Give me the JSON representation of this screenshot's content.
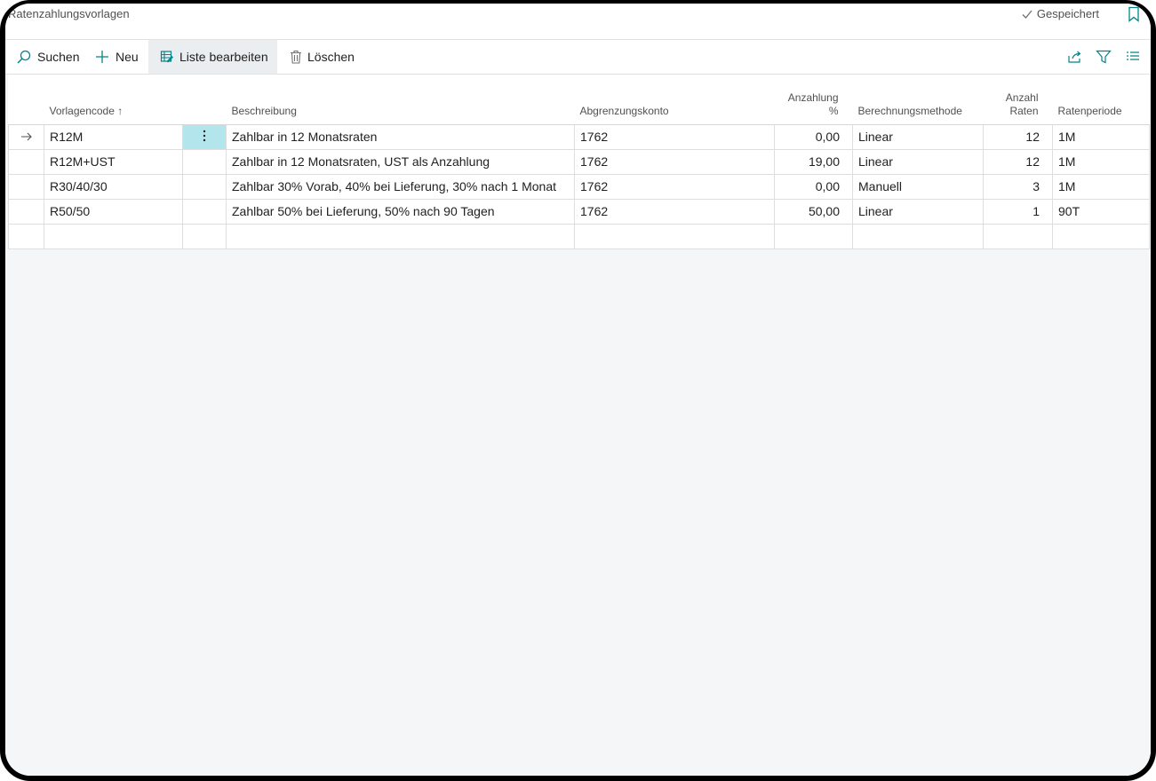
{
  "page": {
    "title": "Ratenzahlungsvorlagen",
    "status": "Gespeichert"
  },
  "actions": {
    "search": "Suchen",
    "new": "Neu",
    "edit_list": "Liste bearbeiten",
    "delete": "Löschen"
  },
  "columns": {
    "code": "Vorlagencode",
    "code_sort": "↑",
    "description": "Beschreibung",
    "account": "Abgrenzungskonto",
    "down_payment_line1": "Anzahlung",
    "down_payment_line2": "%",
    "method": "Berechnungsmethode",
    "count_line1": "Anzahl",
    "count_line2": "Raten",
    "period": "Ratenperiode"
  },
  "rows": [
    {
      "code": "R12M",
      "description": "Zahlbar in 12 Monatsraten",
      "account": "1762",
      "down_payment": "0,00",
      "method": "Linear",
      "count": "12",
      "period": "1M"
    },
    {
      "code": "R12M+UST",
      "description": "Zahlbar in 12 Monatsraten, UST als Anzahlung",
      "account": "1762",
      "down_payment": "19,00",
      "method": "Linear",
      "count": "12",
      "period": "1M"
    },
    {
      "code": "R30/40/30",
      "description": "Zahlbar 30% Vorab, 40% bei Lieferung, 30% nach 1 Monat",
      "account": "1762",
      "down_payment": "0,00",
      "method": "Manuell",
      "count": "3",
      "period": "1M"
    },
    {
      "code": "R50/50",
      "description": "Zahlbar 50% bei Lieferung, 50% nach 90 Tagen",
      "account": "1762",
      "down_payment": "50,00",
      "method": "Linear",
      "count": "1",
      "period": "90T"
    }
  ],
  "colors": {
    "accent": "#008489",
    "selected_cell": "#b3e5ec"
  },
  "icons": {
    "status": "check-icon",
    "bookmark": "bookmark-icon",
    "search": "search-icon",
    "new": "plus-icon",
    "edit_list": "edit-list-icon",
    "delete": "trash-icon",
    "share": "share-icon",
    "filter": "filter-icon",
    "list": "list-icon",
    "row_marker": "arrow-right-icon",
    "row_menu": "more-vertical-icon"
  }
}
